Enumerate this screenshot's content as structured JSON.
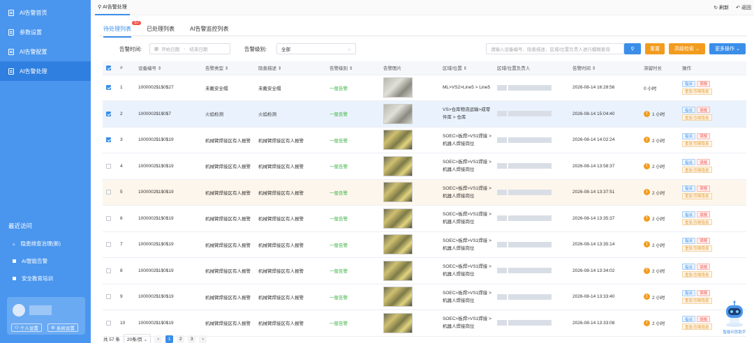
{
  "sidebar": {
    "items": [
      {
        "label": "AI告警首页"
      },
      {
        "label": "参数设置"
      },
      {
        "label": "AI告警配置"
      },
      {
        "label": "AI告警处理"
      }
    ],
    "recent_title": "最近访问",
    "recent": [
      {
        "label": "隐患排查治理(新)"
      },
      {
        "label": "AI智能告警"
      },
      {
        "label": "安全教育培训"
      }
    ],
    "user_buttons": {
      "personal": "个人设置",
      "system": "系统设置"
    }
  },
  "topbar": {
    "tab": "AI告警处理",
    "refresh": "刷新",
    "back": "返回"
  },
  "tabs": [
    {
      "label": "待处理列表",
      "badge": "57"
    },
    {
      "label": "已处理列表"
    },
    {
      "label": "AI告警监控列表"
    }
  ],
  "filter": {
    "time_label": "告警时间:",
    "start_placeholder": "开始日期",
    "sep": "-",
    "end_placeholder": "结束日期",
    "level_label": "告警级别:",
    "level_value": "全部",
    "search_placeholder": "请输入设备编号、隐患描述、区域/位置负责人进行模糊查询",
    "reset": "重置",
    "advanced": "高级检索",
    "more": "更多操作"
  },
  "table": {
    "headers": [
      "#",
      "设备编号",
      "告警类型",
      "隐患描述",
      "告警级别",
      "告警图片",
      "区域/位置",
      "区域/位置负责人",
      "告警时间",
      "滞留时长",
      "操作"
    ],
    "rows": [
      {
        "no": "1",
        "device": "1000002$1$0$27",
        "type": "未戴安全帽",
        "desc": "未戴安全帽",
        "level": "一般告警",
        "area": "ML>VS2>Line5 > Line5",
        "time": "2026-08-14 16:28:56",
        "dur": "0 小时",
        "warn": false,
        "checked": true
      },
      {
        "no": "2",
        "device": "1000002$1$0$7",
        "type": "火焰检测",
        "desc": "火焰检测",
        "level": "一般告警",
        "area": "VS>仓库物流运输>成零件库 > 仓库",
        "time": "2026-08-14 15:04:40",
        "dur": "1 小时",
        "warn": true,
        "checked": true
      },
      {
        "no": "3",
        "device": "1000002$1$0$19",
        "type": "机械臂焊接区有人报警",
        "desc": "机械臂焊接区有人报警",
        "level": "一般告警",
        "area": "SOEC>板焊>VS1焊接 > 机器人焊接岗位",
        "time": "2026-08-14 14:02:24",
        "dur": "2 小时",
        "warn": true,
        "checked": true
      },
      {
        "no": "4",
        "device": "1000002$1$0$19",
        "type": "机械臂焊接区有人报警",
        "desc": "机械臂焊接区有人报警",
        "level": "一般告警",
        "area": "SOEC>板焊>VS1焊接 > 机器人焊接岗位",
        "time": "2026-08-14 13:58:37",
        "dur": "2 小时",
        "warn": true,
        "checked": false
      },
      {
        "no": "5",
        "device": "1000002$1$0$19",
        "type": "机械臂焊接区有人报警",
        "desc": "机械臂焊接区有人报警",
        "level": "一般告警",
        "area": "SOEC>板焊>VS1焊接 > 机器人焊接岗位",
        "time": "2026-08-14 13:37:51",
        "dur": "2 小时",
        "warn": true,
        "checked": false
      },
      {
        "no": "6",
        "device": "1000002$1$0$19",
        "type": "机械臂焊接区有人报警",
        "desc": "机械臂焊接区有人报警",
        "level": "一般告警",
        "area": "SOEC>板焊>VS1焊接 > 机器人焊接岗位",
        "time": "2026-08-14 13:35:37",
        "dur": "2 小时",
        "warn": true,
        "checked": false
      },
      {
        "no": "7",
        "device": "1000002$1$0$19",
        "type": "机械臂焊接区有人报警",
        "desc": "机械臂焊接区有人报警",
        "level": "一般告警",
        "area": "SOEC>板焊>VS1焊接 > 机器人焊接岗位",
        "time": "2026-08-14 13:35:14",
        "dur": "2 小时",
        "warn": true,
        "checked": false
      },
      {
        "no": "8",
        "device": "1000002$1$0$19",
        "type": "机械臂焊接区有人报警",
        "desc": "机械臂焊接区有人报警",
        "level": "一般告警",
        "area": "SOEC>板焊>VS1焊接 > 机器人焊接岗位",
        "time": "2026-08-14 13:34:02",
        "dur": "2 小时",
        "warn": true,
        "checked": false
      },
      {
        "no": "9",
        "device": "1000002$1$0$19",
        "type": "机械臂焊接区有人报警",
        "desc": "机械臂焊接区有人报警",
        "level": "一般告警",
        "area": "SOEC>板焊>VS1焊接 > 机器人焊接岗位",
        "time": "2026-08-14 13:33:40",
        "dur": "2 小时",
        "warn": true,
        "checked": false
      },
      {
        "no": "10",
        "device": "1000002$1$0$19",
        "type": "机械臂焊接区有人报警",
        "desc": "机械臂焊接区有人报警",
        "level": "一般告警",
        "area": "SOEC>板焊>VS1焊接 > 机器人焊接岗位",
        "time": "2026-08-14 13:33:08",
        "dur": "2 小时",
        "warn": true,
        "checked": false
      }
    ],
    "ops": {
      "dispatch": "指派",
      "misreport": "误报",
      "rectify": "重复/忽略隐患"
    }
  },
  "pager": {
    "total": "共 57 条",
    "size": "20条/页",
    "pages": [
      "1",
      "2",
      "3"
    ]
  },
  "assistant": "智能问答助手",
  "colors": {
    "sidebar": "#4a96ee",
    "accent": "#3b8ee8",
    "ok": "#3cb043",
    "warn": "#f29c1f",
    "danger": "#f0564d"
  }
}
